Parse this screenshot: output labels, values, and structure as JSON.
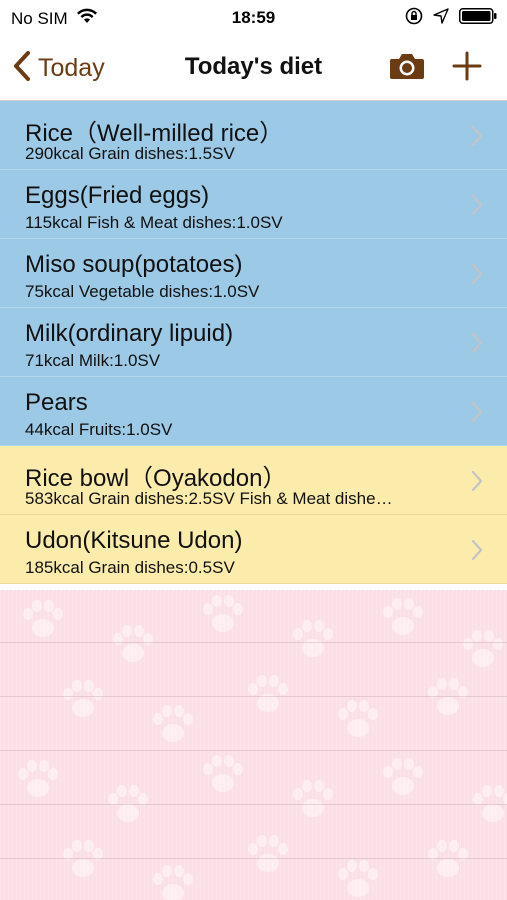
{
  "status_bar": {
    "carrier": "No SIM",
    "time": "18:59",
    "icons": [
      "wifi-icon",
      "rotation-lock-icon",
      "location-arrow-icon",
      "battery-icon"
    ]
  },
  "nav": {
    "back_label": "Today",
    "title": "Today's diet",
    "icons": [
      "chevron-left-icon",
      "camera-icon",
      "plus-icon"
    ]
  },
  "colors": {
    "blue_row": "#9bc9e6",
    "yellow_row": "#fcecab",
    "empty_bg": "#fbdfe6",
    "nav_accent": "#6b3b12"
  },
  "meals": [
    {
      "name": "Rice（Well-milled rice）",
      "detail": "290kcal Grain dishes:1.5SV",
      "color": "blue"
    },
    {
      "name": "Eggs(Fried eggs)",
      "detail": "115kcal Fish & Meat dishes:1.0SV",
      "color": "blue"
    },
    {
      "name": "Miso soup(potatoes)",
      "detail": "75kcal Vegetable dishes:1.0SV",
      "color": "blue"
    },
    {
      "name": "Milk(ordinary lipuid)",
      "detail": "71kcal Milk:1.0SV",
      "color": "blue"
    },
    {
      "name": "Pears",
      "detail": "44kcal Fruits:1.0SV",
      "color": "blue"
    },
    {
      "name": "Rice bowl（Oyakodon）",
      "detail": "583kcal Grain dishes:2.5SV Fish & Meat dishe…",
      "color": "yellow"
    },
    {
      "name": "Udon(Kitsune Udon)",
      "detail": "185kcal Grain dishes:0.5SV",
      "color": "yellow"
    }
  ]
}
